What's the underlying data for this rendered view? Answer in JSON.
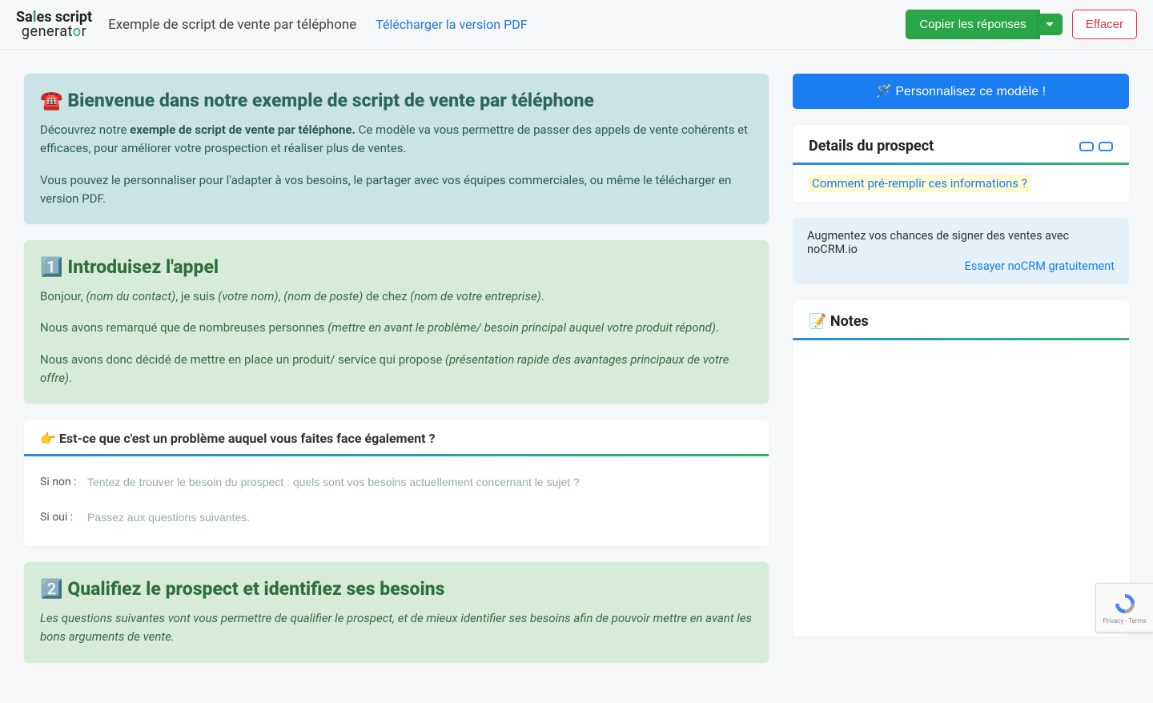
{
  "topbar": {
    "logo_line1_pre": "Sa",
    "logo_line1_accent": "l",
    "logo_line1_post": "es script",
    "logo_line2_pre": "generat",
    "logo_line2_accent": "o",
    "logo_line2_post": "r",
    "title": "Exemple de script de vente par téléphone",
    "pdf_link": "Télécharger la version PDF",
    "copy_button": "Copier les réponses",
    "clear_button": "Effacer"
  },
  "welcome": {
    "title": "☎️ Bienvenue dans notre exemple de script de vente par téléphone",
    "p1_pre": "Découvrez notre ",
    "p1_bold": "exemple de script de vente par téléphone.",
    "p1_post": " Ce modèle va vous permettre de passer des appels de vente cohérents et efficaces, pour améliorer votre prospection et réaliser plus de ventes.",
    "p2": "Vous pouvez le personnaliser pour l'adapter à vos besoins, le partager avec vos équipes commerciales, ou même le télécharger en version PDF."
  },
  "intro_call": {
    "title": "1️⃣ Introduisez l'appel",
    "l1_a": "Bonjour, ",
    "l1_b": "(nom du contact)",
    "l1_c": ", je suis ",
    "l1_d": "(votre nom)",
    "l1_e": ", ",
    "l1_f": "(nom de poste)",
    "l1_g": " de chez ",
    "l1_h": "(nom de votre entreprise)",
    "l1_i": ".",
    "l2_a": "Nous avons remarqué que de nombreuses personnes ",
    "l2_b": "(mettre en avant le problème/ besoin principal auquel votre produit répond)",
    "l2_c": ".",
    "l3_a": "Nous avons donc décidé de mettre en place un produit/ service qui propose ",
    "l3_b": "(présentation rapide des avantages principaux de votre offre)",
    "l3_c": "."
  },
  "question1": {
    "header": "👉 Est-ce que c'est un problème auquel vous faites face également ?",
    "answers": [
      {
        "label": "Si non :",
        "placeholder": "Tentez de trouver le besoin du prospect : quels sont vos besoins actuellement concernant le sujet ?"
      },
      {
        "label": "Si oui :",
        "placeholder": "Passez aux questions suivantes."
      }
    ]
  },
  "qualify": {
    "title": "2️⃣ Qualifiez le prospect et identifiez ses besoins",
    "desc": "Les questions suivantes vont vous permettre de qualifier le prospect, et de mieux identifier ses besoins afin de pouvoir mettre en avant les bons arguments de vente."
  },
  "right": {
    "personalize": "🪄 Personnalisez ce modèle !",
    "prospect_header": "Details du prospect",
    "prefill": "Comment pré-remplir ces informations ?",
    "promo_text": "Augmentez vos chances de signer des ventes avec noCRM.io",
    "promo_link": "Essayer noCRM gratuitement",
    "notes_header": "📝 Notes"
  },
  "recaptcha": {
    "line1": "Privacy",
    "sep": " - ",
    "line2": "Terms"
  }
}
